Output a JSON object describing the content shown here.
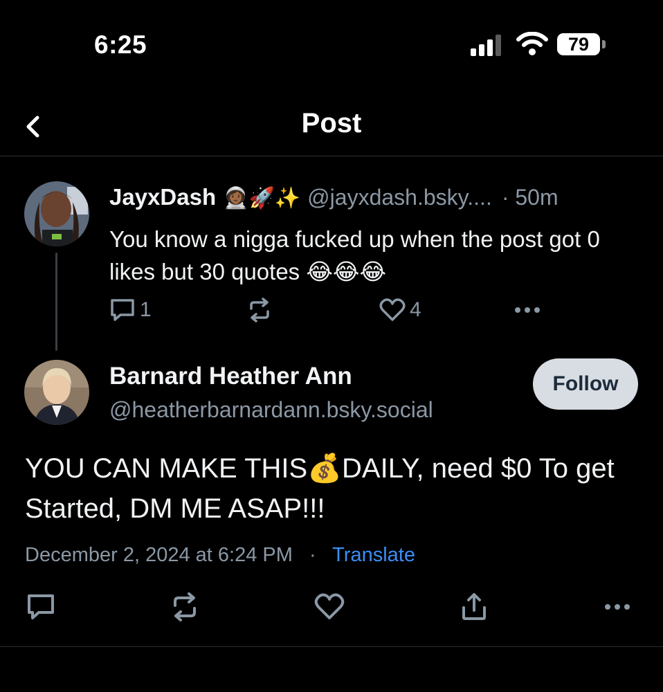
{
  "status_bar": {
    "time": "6:25",
    "battery_percent": "79",
    "icons": [
      "signal-icon",
      "wifi-icon",
      "battery-icon"
    ]
  },
  "header": {
    "title": "Post",
    "back_icon": "chevron-left-icon"
  },
  "parent_post": {
    "author_name": "JayxDash",
    "author_emojis": "👩🏾‍🚀🚀✨",
    "author_handle": "@jayxdash.bsky....",
    "age": "· 50m",
    "text": "You know a nigga fucked up when the post got 0 likes but 30 quotes 😂😂😂",
    "actions": {
      "reply_count": "1",
      "repost_count": "",
      "like_count": "4"
    }
  },
  "reply_post": {
    "author_name": "Barnard Heather Ann",
    "author_handle": "@heatherbarnardann.bsky.social",
    "follow_label": "Follow",
    "text": "YOU CAN MAKE THIS💰DAILY, need $0 To get Started, DM ME ASAP!!!",
    "timestamp": "December 2, 2024 at 6:24 PM",
    "separator": "·",
    "translate_label": "Translate"
  },
  "colors": {
    "background": "#000000",
    "text_primary": "#f1f3f5",
    "text_secondary": "#8b98a5",
    "link": "#3b8ef6",
    "follow_bg": "#d8dde3"
  }
}
